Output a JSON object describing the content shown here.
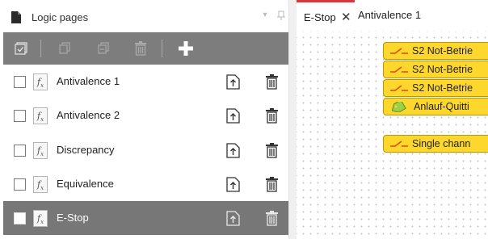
{
  "panel": {
    "title": "Logic pages",
    "icons": {
      "page": "page-icon",
      "pin": "pin-icon",
      "dropdown": "dropdown-icon"
    }
  },
  "toolbar": {
    "buttons": [
      {
        "name": "select-all-icon",
        "enabled": true
      },
      {
        "name": "copy-icon",
        "enabled": false
      },
      {
        "name": "duplicate-icon",
        "enabled": false
      },
      {
        "name": "delete-icon",
        "enabled": false
      },
      {
        "name": "add-icon",
        "enabled": true
      }
    ]
  },
  "list": {
    "items": [
      {
        "label": "Antivalence 1",
        "checked": false,
        "selected": false
      },
      {
        "label": "Antivalence 2",
        "checked": false,
        "selected": false
      },
      {
        "label": "Discrepancy",
        "checked": false,
        "selected": false
      },
      {
        "label": "Equivalence",
        "checked": false,
        "selected": false
      },
      {
        "label": "E-Stop",
        "checked": false,
        "selected": true
      }
    ],
    "fx_symbol": "f",
    "fx_subscript": "x",
    "row_icons": [
      "function-icon",
      "export-icon",
      "trash-icon"
    ]
  },
  "tabs": [
    {
      "label": "E-Stop",
      "active": true,
      "close": "✕"
    },
    {
      "label": "Antivalence 1",
      "active": false
    }
  ],
  "canvas": {
    "blocks": [
      {
        "text": "S2 Not-Betrie",
        "icon": "switch-icon"
      },
      {
        "text": "S2 Not-Betrie",
        "icon": "switch-icon"
      },
      {
        "text": "S2 Not-Betrie",
        "icon": "switch-icon"
      },
      {
        "text": "Anlauf-Quitti",
        "icon": "tag-icon"
      },
      {
        "text": "Single chann",
        "icon": "switch-icon"
      }
    ]
  },
  "colors": {
    "toolbar": "#7d7d7d",
    "selected_row": "#777777",
    "active_tab_accent": "#d9363e",
    "block_fill": "#fdd72c",
    "block_border": "#b8960a",
    "switch_icon": "#e04a12",
    "tag_icon": "#6aa32a"
  }
}
